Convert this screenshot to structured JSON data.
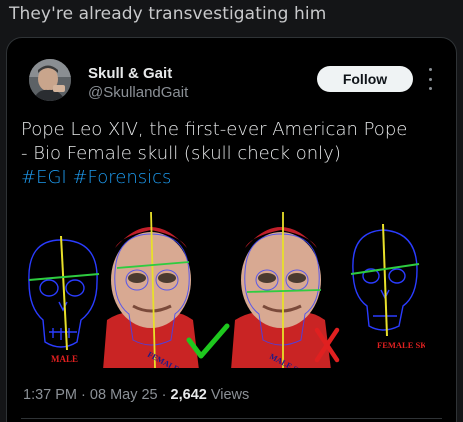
{
  "caption": "They're already transvestigating him",
  "tweet": {
    "author": {
      "name": "Skull & Gait",
      "handle": "@SkullandGait"
    },
    "follow_label": "Follow",
    "text_line1": "Pope Leo XIV, the first-ever American Pope",
    "text_line2": "- Bio Female skull (skull check only)",
    "hashtags": [
      "#EGI",
      "#Forensics"
    ],
    "time": "1:37 PM",
    "date": "08 May 25",
    "separator": "·",
    "views_count": "2,642",
    "views_label": "Views"
  },
  "image": {
    "label_male": "MALE",
    "label_female_left": "FEMALE SKULL",
    "label_male_right": "MALE SKULL",
    "label_female_right": "FEMALE SKULL"
  },
  "colors": {
    "background": "#141517",
    "card": "#000000",
    "hashtag": "#1d9bf0",
    "check": "#1ec81e",
    "cross": "#e02020",
    "skull_lines": "#2a3cff",
    "vertical_line": "#e8e02a",
    "horizontal_line": "#2ecc40"
  }
}
